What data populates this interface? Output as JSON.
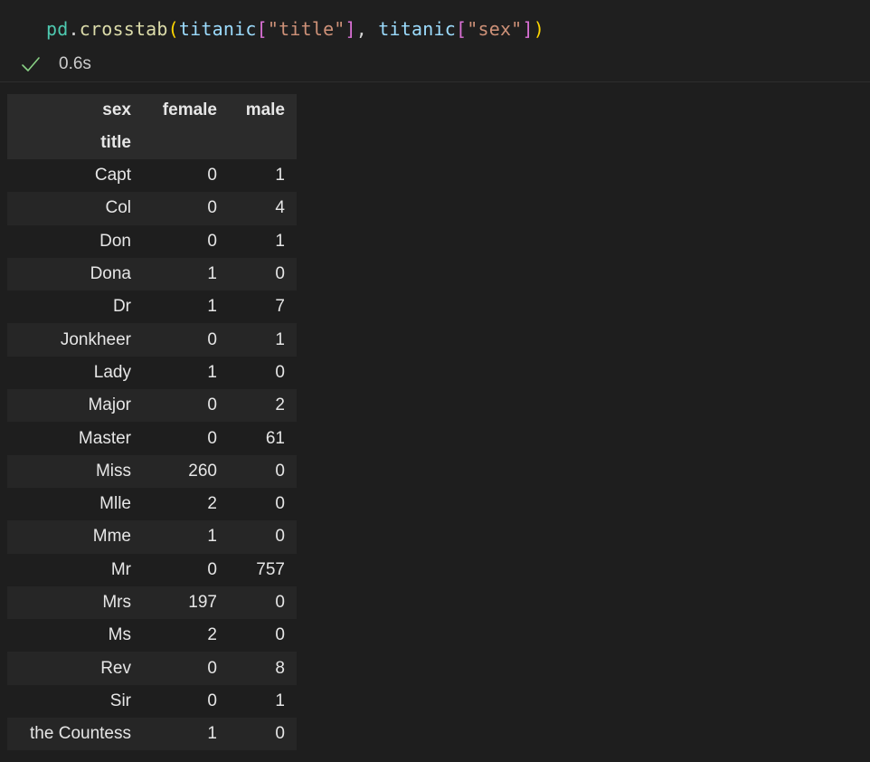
{
  "cell": {
    "code_tokens": [
      {
        "text": "pd",
        "cls": "tok-module"
      },
      {
        "text": ".",
        "cls": "tok-punct"
      },
      {
        "text": "crosstab",
        "cls": "tok-func"
      },
      {
        "text": "(",
        "cls": "tok-paren"
      },
      {
        "text": "titanic",
        "cls": "tok-var"
      },
      {
        "text": "[",
        "cls": "tok-bracket"
      },
      {
        "text": "\"title\"",
        "cls": "tok-string"
      },
      {
        "text": "]",
        "cls": "tok-bracket"
      },
      {
        "text": ", ",
        "cls": "tok-punct"
      },
      {
        "text": "titanic",
        "cls": "tok-var"
      },
      {
        "text": "[",
        "cls": "tok-bracket"
      },
      {
        "text": "\"sex\"",
        "cls": "tok-string"
      },
      {
        "text": "]",
        "cls": "tok-bracket"
      },
      {
        "text": ")",
        "cls": "tok-paren"
      }
    ],
    "status_icon": "check-icon",
    "exec_time": "0.6s",
    "status_color": "#89d185"
  },
  "table": {
    "columns_name": "sex",
    "columns": [
      "female",
      "male"
    ],
    "index_name": "title",
    "rows": [
      {
        "label": "Capt",
        "values": [
          "0",
          "1"
        ]
      },
      {
        "label": "Col",
        "values": [
          "0",
          "4"
        ]
      },
      {
        "label": "Don",
        "values": [
          "0",
          "1"
        ]
      },
      {
        "label": "Dona",
        "values": [
          "1",
          "0"
        ]
      },
      {
        "label": "Dr",
        "values": [
          "1",
          "7"
        ]
      },
      {
        "label": "Jonkheer",
        "values": [
          "0",
          "1"
        ]
      },
      {
        "label": "Lady",
        "values": [
          "1",
          "0"
        ]
      },
      {
        "label": "Major",
        "values": [
          "0",
          "2"
        ]
      },
      {
        "label": "Master",
        "values": [
          "0",
          "61"
        ]
      },
      {
        "label": "Miss",
        "values": [
          "260",
          "0"
        ]
      },
      {
        "label": "Mlle",
        "values": [
          "2",
          "0"
        ]
      },
      {
        "label": "Mme",
        "values": [
          "1",
          "0"
        ]
      },
      {
        "label": "Mr",
        "values": [
          "0",
          "757"
        ]
      },
      {
        "label": "Mrs",
        "values": [
          "197",
          "0"
        ]
      },
      {
        "label": "Ms",
        "values": [
          "2",
          "0"
        ]
      },
      {
        "label": "Rev",
        "values": [
          "0",
          "8"
        ]
      },
      {
        "label": "Sir",
        "values": [
          "0",
          "1"
        ]
      },
      {
        "label": "the Countess",
        "values": [
          "1",
          "0"
        ]
      }
    ]
  }
}
